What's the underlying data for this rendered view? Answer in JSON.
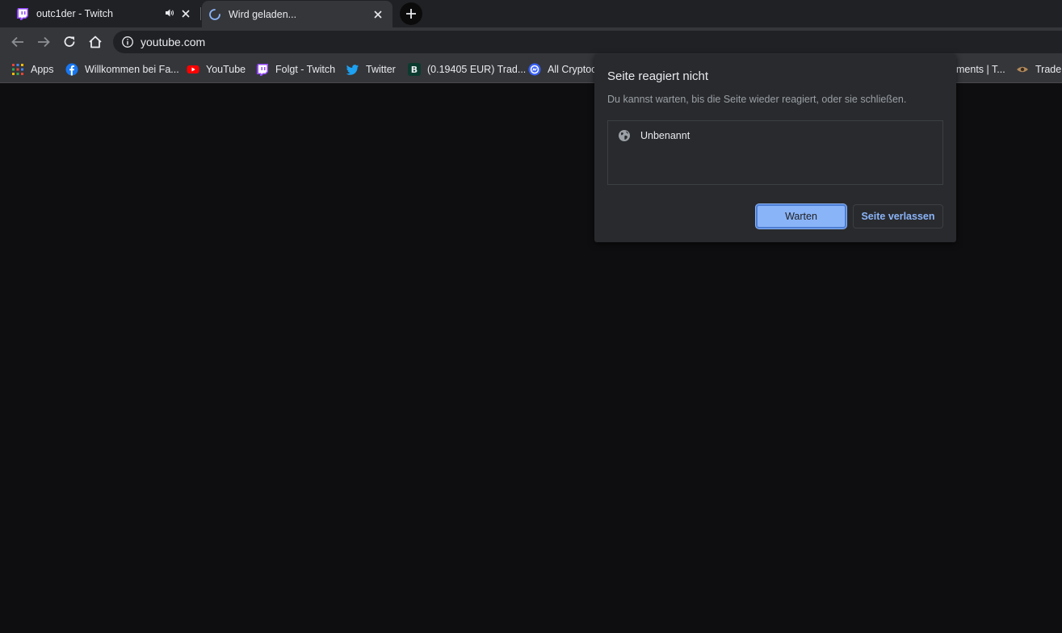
{
  "tabs": [
    {
      "title": "outc1der - Twitch",
      "favicon": "twitch-icon",
      "audio": "speaker-icon",
      "active": false
    },
    {
      "title": "Wird geladen...",
      "favicon": "loading-spinner-icon",
      "active": true
    }
  ],
  "toolbar": {
    "url": "youtube.com"
  },
  "bookmarks": {
    "apps": "Apps",
    "facebook": "Willkommen bei Fa...",
    "youtube": "YouTube",
    "twitch": "Folgt - Twitch",
    "twitter": "Twitter",
    "trade": "(0.19405 EUR) Trad...",
    "crypto": "All Cryptoc",
    "ments": "ments | T...",
    "trade2": "Trade"
  },
  "dialog": {
    "title": "Seite reagiert nicht",
    "message": "Du kannst warten, bis die Seite wieder reagiert, oder sie schließen.",
    "page_name": "Unbenannt",
    "wait_label": "Warten",
    "leave_label": "Seite verlassen"
  },
  "colors": {
    "accent": "#8ab4f8",
    "twitch": "#9146ff",
    "youtube": "#ff0000",
    "twitter": "#1da1f2",
    "facebook": "#1877f2"
  }
}
